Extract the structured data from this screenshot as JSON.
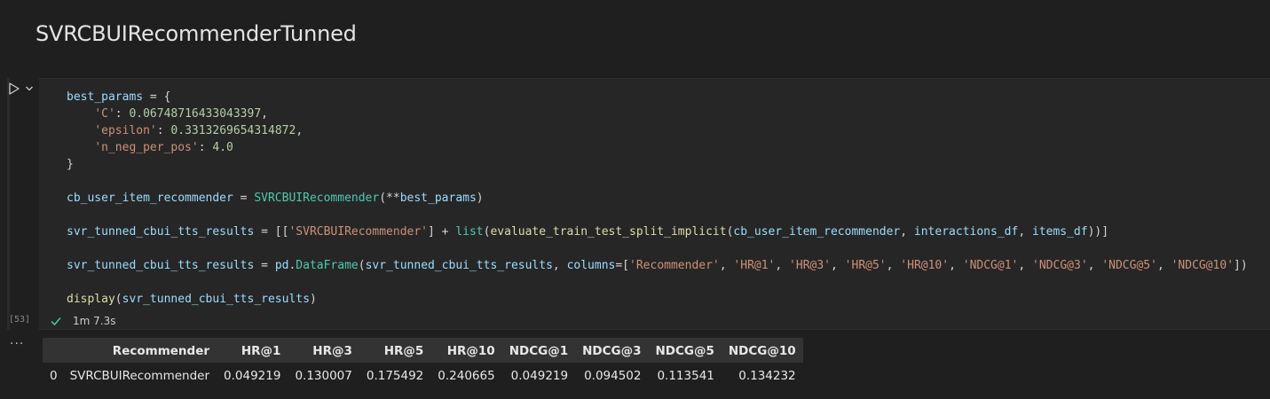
{
  "markdown": {
    "title": "SVRCBUIRecommenderTunned"
  },
  "cell": {
    "execution_count": "[53]",
    "status": {
      "duration": "1m 7.3s"
    },
    "code_lines": [
      [
        {
          "t": "v",
          "x": "best_params"
        },
        {
          "t": "p",
          "x": " = {"
        }
      ],
      [
        {
          "t": "p",
          "x": "    "
        },
        {
          "t": "s",
          "x": "'C'"
        },
        {
          "t": "p",
          "x": ": "
        },
        {
          "t": "n",
          "x": "0.06748716433043397"
        },
        {
          "t": "p",
          "x": ","
        }
      ],
      [
        {
          "t": "p",
          "x": "    "
        },
        {
          "t": "s",
          "x": "'epsilon'"
        },
        {
          "t": "p",
          "x": ": "
        },
        {
          "t": "n",
          "x": "0.3313269654314872"
        },
        {
          "t": "p",
          "x": ","
        }
      ],
      [
        {
          "t": "p",
          "x": "    "
        },
        {
          "t": "s",
          "x": "'n_neg_per_pos'"
        },
        {
          "t": "p",
          "x": ": "
        },
        {
          "t": "n",
          "x": "4.0"
        }
      ],
      [
        {
          "t": "p",
          "x": "}"
        }
      ],
      [],
      [
        {
          "t": "v",
          "x": "cb_user_item_recommender"
        },
        {
          "t": "p",
          "x": " = "
        },
        {
          "t": "c",
          "x": "SVRCBUIRecommender"
        },
        {
          "t": "p",
          "x": "(**"
        },
        {
          "t": "v",
          "x": "best_params"
        },
        {
          "t": "p",
          "x": ")"
        }
      ],
      [],
      [
        {
          "t": "v",
          "x": "svr_tunned_cbui_tts_results"
        },
        {
          "t": "p",
          "x": " = [["
        },
        {
          "t": "s",
          "x": "'SVRCBUIRecommender'"
        },
        {
          "t": "p",
          "x": "] + "
        },
        {
          "t": "c",
          "x": "list"
        },
        {
          "t": "p",
          "x": "("
        },
        {
          "t": "f",
          "x": "evaluate_train_test_split_implicit"
        },
        {
          "t": "p",
          "x": "("
        },
        {
          "t": "v",
          "x": "cb_user_item_recommender"
        },
        {
          "t": "p",
          "x": ", "
        },
        {
          "t": "v",
          "x": "interactions_df"
        },
        {
          "t": "p",
          "x": ", "
        },
        {
          "t": "v",
          "x": "items_df"
        },
        {
          "t": "p",
          "x": "))]"
        }
      ],
      [],
      [
        {
          "t": "v",
          "x": "svr_tunned_cbui_tts_results"
        },
        {
          "t": "p",
          "x": " = "
        },
        {
          "t": "v",
          "x": "pd"
        },
        {
          "t": "p",
          "x": "."
        },
        {
          "t": "c",
          "x": "DataFrame"
        },
        {
          "t": "p",
          "x": "("
        },
        {
          "t": "v",
          "x": "svr_tunned_cbui_tts_results"
        },
        {
          "t": "p",
          "x": ", "
        },
        {
          "t": "v",
          "x": "columns"
        },
        {
          "t": "p",
          "x": "=["
        },
        {
          "t": "s",
          "x": "'Recommender'"
        },
        {
          "t": "p",
          "x": ", "
        },
        {
          "t": "s",
          "x": "'HR@1'"
        },
        {
          "t": "p",
          "x": ", "
        },
        {
          "t": "s",
          "x": "'HR@3'"
        },
        {
          "t": "p",
          "x": ", "
        },
        {
          "t": "s",
          "x": "'HR@5'"
        },
        {
          "t": "p",
          "x": ", "
        },
        {
          "t": "s",
          "x": "'HR@10'"
        },
        {
          "t": "p",
          "x": ", "
        },
        {
          "t": "s",
          "x": "'NDCG@1'"
        },
        {
          "t": "p",
          "x": ", "
        },
        {
          "t": "s",
          "x": "'NDCG@3'"
        },
        {
          "t": "p",
          "x": ", "
        },
        {
          "t": "s",
          "x": "'NDCG@5'"
        },
        {
          "t": "p",
          "x": ", "
        },
        {
          "t": "s",
          "x": "'NDCG@10'"
        },
        {
          "t": "p",
          "x": "])"
        }
      ],
      [],
      [
        {
          "t": "f",
          "x": "display"
        },
        {
          "t": "p",
          "x": "("
        },
        {
          "t": "v",
          "x": "svr_tunned_cbui_tts_results"
        },
        {
          "t": "p",
          "x": ")"
        }
      ]
    ]
  },
  "output": {
    "more_label": "···",
    "table": {
      "columns": [
        "",
        "Recommender",
        "HR@1",
        "HR@3",
        "HR@5",
        "HR@10",
        "NDCG@1",
        "NDCG@3",
        "NDCG@5",
        "NDCG@10"
      ],
      "rows": [
        [
          "0",
          "SVRCBUIRecommender",
          "0.049219",
          "0.130007",
          "0.175492",
          "0.240665",
          "0.049219",
          "0.094502",
          "0.113541",
          "0.134232"
        ]
      ]
    }
  },
  "icons": {
    "run": "run-icon",
    "chevron": "chevron-down-icon",
    "check": "check-icon"
  },
  "colors": {
    "success": "#4ec9a0",
    "variable": "#9cdcfe",
    "string": "#ce9178",
    "number": "#b5cea8",
    "function": "#dcdcaa",
    "class": "#4ec9b0"
  }
}
